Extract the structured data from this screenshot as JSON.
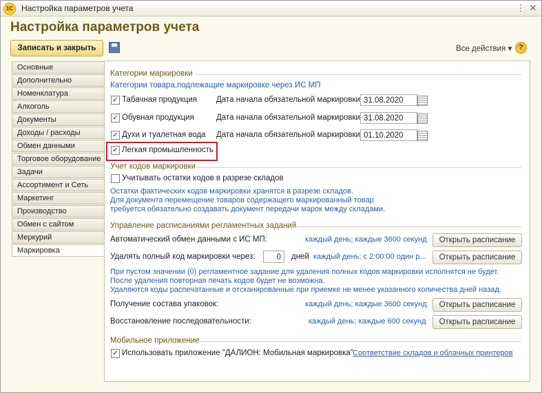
{
  "window": {
    "title": "Настройка параметров учета",
    "logo": "1С"
  },
  "page_title": "Настройка параметров учета",
  "toolbar": {
    "save_close": "Записать и закрыть",
    "all_actions": "Все действия",
    "help": "?"
  },
  "tabs": [
    "Основные",
    "Дополнительно",
    "Номенклатура",
    "Алкоголь",
    "Документы",
    "Доходы / расходы",
    "Обмен данными",
    "Торговое оборудование",
    "Задачи",
    "Ассортимент и Сеть",
    "Маркетинг",
    "Производство",
    "Обмен с сайтом",
    "Меркурий",
    "Маркировка"
  ],
  "active_tab": "Маркировка",
  "categories": {
    "title": "Категории маркировки",
    "subtitle": "Категории товара,подлежащие маркировке через ИС МП",
    "date_label": "Дата начала обязательной маркировки:",
    "items": [
      {
        "label": "Табачная продукция",
        "checked": true,
        "date": "31.08.2020"
      },
      {
        "label": "Обувная продукция",
        "checked": true,
        "date": "31.08.2020"
      },
      {
        "label": "Духи и туалетная вода",
        "checked": true,
        "date": "01.10.2020"
      },
      {
        "label": "Легкая промышленность",
        "checked": true
      }
    ]
  },
  "codes": {
    "title": "Учет кодов маркировки",
    "checkbox": "Учитывать остатки кодов в разрезе складов",
    "note1": "Остатки фактических кодов маркировки хранятся в разрезе складов.",
    "note2": "Для документа перемещение товаров содержащего маркированный товар",
    "note3": "требуется обязательно создавать документ передачи марок между складами."
  },
  "schedule": {
    "title": "Управление расписаниями регламентных заданий",
    "row1": {
      "label": "Автоматический обмен данными с ИС МП:",
      "value": "каждый день; каждые 3600 секунд",
      "button": "Открыть расписание"
    },
    "row2": {
      "label": "Удалять полный код маркировки через:",
      "days": "0",
      "unit": "дней",
      "value": "каждый день; с 2:00:00 один р...",
      "button": "Открыть расписание"
    },
    "note1": "При пустом значении (0) регламентное задание для удаления полных кодов маркировки исполнятся не будет.",
    "note2": "После удаления повторная печать кодов будет не возможна.",
    "note3": "Удаляются коды распечатанные и отсканированные при приемке не менее указанного количества дней назад.",
    "row3": {
      "label": "Получение состава упаковок:",
      "value": "каждый день; каждые 3600 секунд",
      "button": "Открыть расписание"
    },
    "row4": {
      "label": "Восстановление последовательности:",
      "value": "каждый день; каждые 600 секунд",
      "button": "Открыть расписание"
    }
  },
  "mobile": {
    "title": "Мобильное приложение",
    "checkbox": "Использовать приложение \"ДАЛИОН: Мобильная маркировка\"",
    "link": "Соответствие складов и облачных принтеров"
  },
  "colors": {
    "accent_title": "#6b5a14",
    "link_blue": "#2a5caa",
    "highlight_red": "#c0202c"
  }
}
